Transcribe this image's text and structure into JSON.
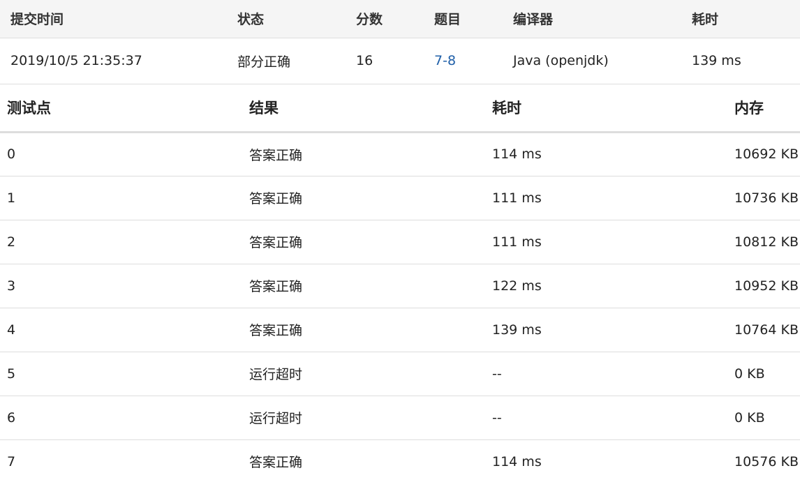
{
  "summary": {
    "headers": {
      "submit_time": "提交时间",
      "status": "状态",
      "score": "分数",
      "problem": "题目",
      "compiler": "编译器",
      "time": "耗时"
    },
    "row": {
      "submit_time": "2019/10/5 21:35:37",
      "status": "部分正确",
      "score": "16",
      "problem": "7-8",
      "compiler": "Java (openjdk)",
      "time": "139 ms"
    }
  },
  "cases": {
    "headers": {
      "case": "测试点",
      "result": "结果",
      "time": "耗时",
      "memory": "内存"
    },
    "rows": [
      {
        "case": "0",
        "result": "答案正确",
        "time": "114 ms",
        "memory": "10692 KB"
      },
      {
        "case": "1",
        "result": "答案正确",
        "time": "111 ms",
        "memory": "10736 KB"
      },
      {
        "case": "2",
        "result": "答案正确",
        "time": "111 ms",
        "memory": "10812 KB"
      },
      {
        "case": "3",
        "result": "答案正确",
        "time": "122 ms",
        "memory": "10952 KB"
      },
      {
        "case": "4",
        "result": "答案正确",
        "time": "139 ms",
        "memory": "10764 KB"
      },
      {
        "case": "5",
        "result": "运行超时",
        "time": "--",
        "memory": "0 KB"
      },
      {
        "case": "6",
        "result": "运行超时",
        "time": "--",
        "memory": "0 KB"
      },
      {
        "case": "7",
        "result": "答案正确",
        "time": "114 ms",
        "memory": "10576 KB"
      }
    ]
  },
  "colors": {
    "accepted": "#d9534f",
    "time_limit_exceeded": "#3aa54a",
    "partial": "#2e9e3a",
    "link": "#1f5fa8"
  }
}
